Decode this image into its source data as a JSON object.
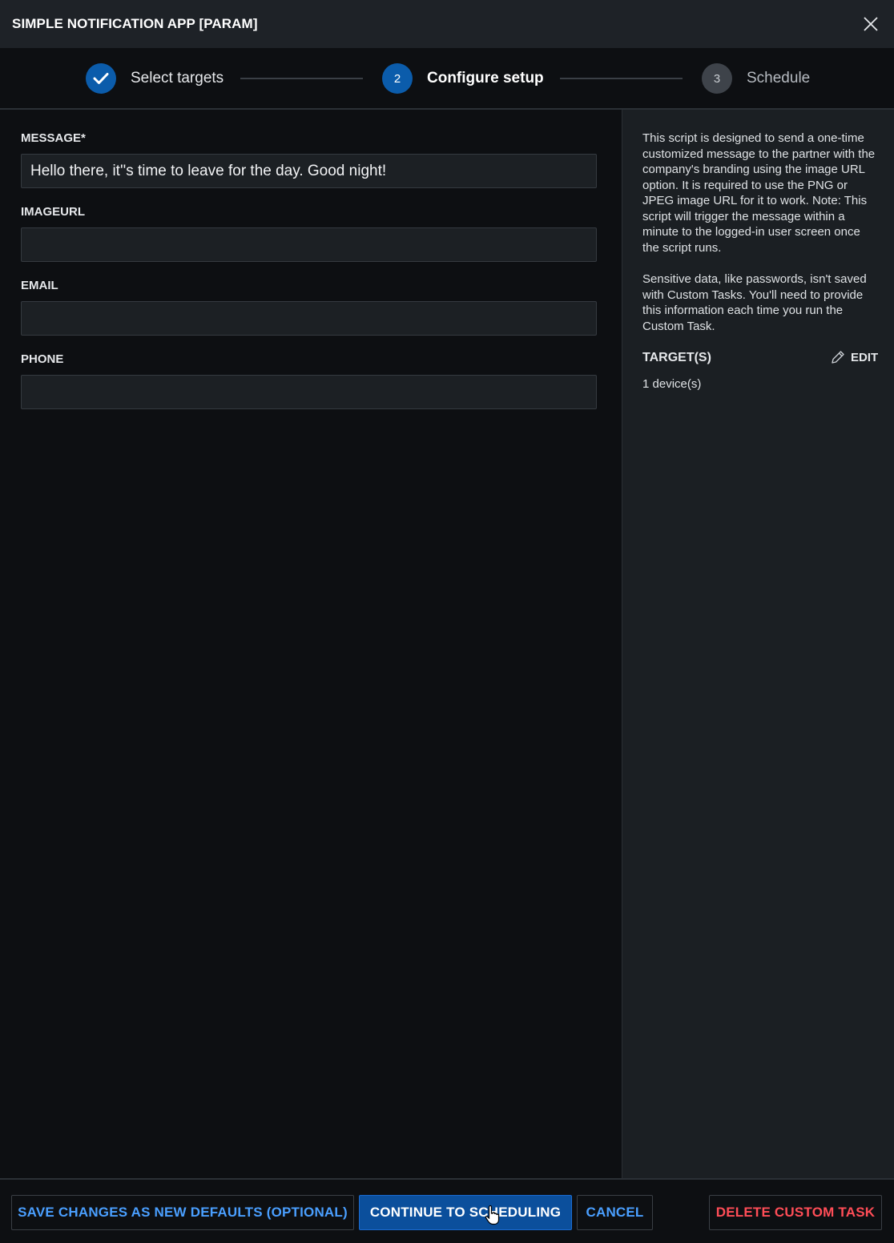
{
  "window": {
    "title": "SIMPLE NOTIFICATION APP [PARAM]",
    "close_icon": "close-icon"
  },
  "stepper": {
    "steps": [
      {
        "number": "",
        "label": "Select targets",
        "state": "done"
      },
      {
        "number": "2",
        "label": "Configure setup",
        "state": "active"
      },
      {
        "number": "3",
        "label": "Schedule",
        "state": "pending"
      }
    ]
  },
  "form": {
    "message": {
      "label": "MESSAGE*",
      "value": "Hello there, it''s time to leave for the day. Good night!",
      "placeholder": ""
    },
    "imageurl": {
      "label": "IMAGEURL",
      "value": "",
      "placeholder": ""
    },
    "email": {
      "label": "EMAIL",
      "value": "",
      "placeholder": ""
    },
    "phone": {
      "label": "PHONE",
      "value": "",
      "placeholder": ""
    }
  },
  "sidebar": {
    "description": "This script is designed to send a one-time customized message to the partner with the company's branding using the image URL option. It is required to use the PNG or JPEG image URL for it to work. Note: This script will trigger the message within a minute to the logged-in user screen once the script runs.",
    "sensitive_note": "Sensitive data, like passwords, isn't saved with Custom Tasks. You'll need to provide this information each time you run the Custom Task.",
    "targets_heading": "TARGET(S)",
    "edit_label": "EDIT",
    "targets_count": "1 device(s)"
  },
  "footer": {
    "save_defaults_label": "SAVE CHANGES AS NEW DEFAULTS (OPTIONAL)",
    "continue_label": "CONTINUE TO SCHEDULING",
    "cancel_label": "CANCEL",
    "delete_label": "DELETE CUSTOM TASK"
  },
  "colors": {
    "accent": "#0b5cab",
    "link": "#4a9fff",
    "danger": "#ff4d57"
  }
}
